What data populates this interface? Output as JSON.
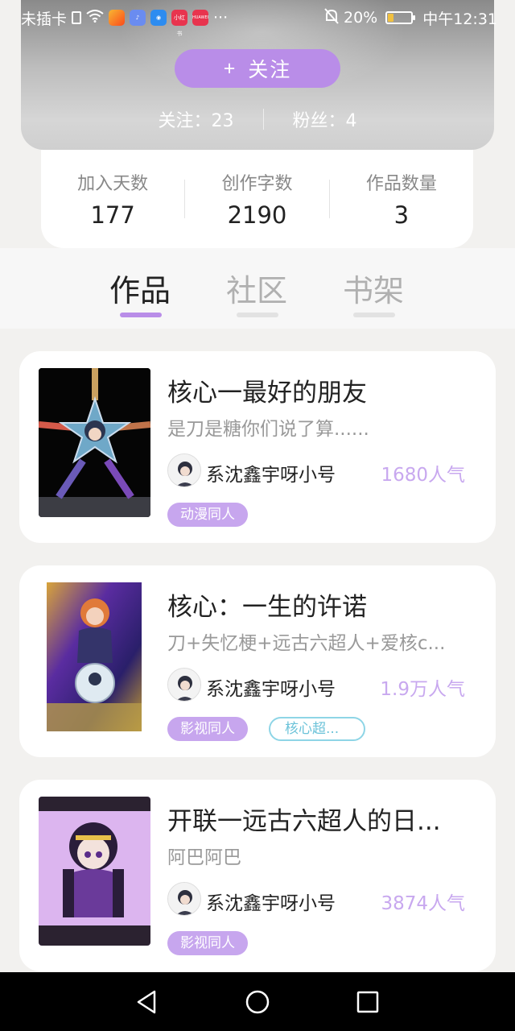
{
  "status_bar": {
    "carrier": "未插卡",
    "battery": "20%",
    "time": "中午12:31",
    "apps": [
      "小红书",
      "HUAWEI"
    ]
  },
  "profile": {
    "follow_button_label": "关注",
    "follow_button_icon": "+",
    "following": "关注：23",
    "fans": "粉丝：4"
  },
  "stats": [
    {
      "label": "加入天数",
      "value": "177"
    },
    {
      "label": "创作字数",
      "value": "2190"
    },
    {
      "label": "作品数量",
      "value": "3"
    }
  ],
  "tabs": [
    {
      "label": "作品",
      "active": true
    },
    {
      "label": "社区",
      "active": false
    },
    {
      "label": "书架",
      "active": false
    }
  ],
  "works": [
    {
      "title": "核心一最好的朋友",
      "desc": "是刀是糖你们说了算......",
      "author": "系沈鑫宇呀小号",
      "popularity": "1680人气",
      "tags": [
        {
          "label": "动漫同人",
          "style": "fill"
        }
      ]
    },
    {
      "title": "核心：一生的许诺",
      "desc": "刀+失忆梗+远古六超人+爱核c...",
      "author": "系沈鑫宇呀小号",
      "popularity": "1.9万人气",
      "tags": [
        {
          "label": "影视同人",
          "style": "fill"
        },
        {
          "label": "核心超...",
          "style": "outline"
        }
      ]
    },
    {
      "title": "开联一远古六超人的日...",
      "desc": "阿巴阿巴",
      "author": "系沈鑫宇呀小号",
      "popularity": "3874人气",
      "tags": [
        {
          "label": "影视同人",
          "style": "fill"
        }
      ]
    }
  ],
  "colors": {
    "accent": "#b98de8",
    "popularity": "#c8a8ef",
    "outline_tag": "#8ed5e6"
  }
}
